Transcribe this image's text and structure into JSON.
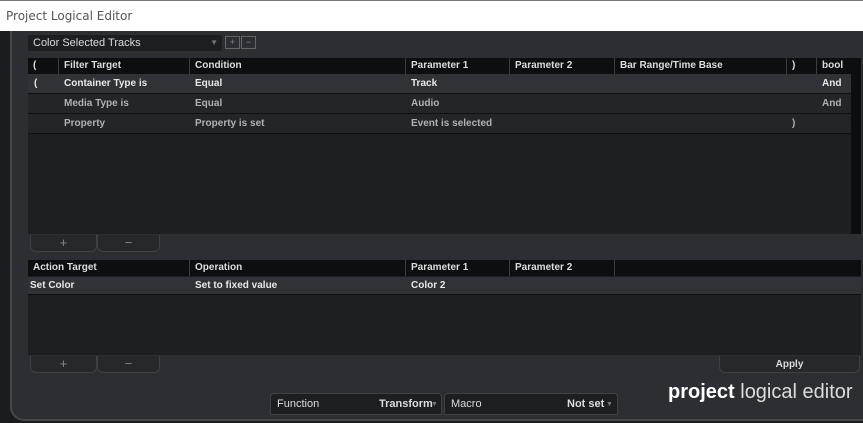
{
  "window": {
    "title": "Project Logical Editor"
  },
  "preset": {
    "value": "Color Selected Tracks",
    "icons": [
      "add-preset-icon",
      "remove-preset-icon"
    ]
  },
  "filter_table": {
    "headers": [
      "(",
      "Filter Target",
      "Condition",
      "Parameter 1",
      "Parameter 2",
      "Bar Range/Time Base",
      ")",
      "bool"
    ],
    "rows": [
      [
        "(",
        "Container Type is",
        "Equal",
        "Track",
        "",
        "",
        "",
        "And"
      ],
      [
        "",
        "Media Type is",
        "Equal",
        "Audio",
        "",
        "",
        "",
        "And"
      ],
      [
        "",
        "Property",
        "Property is set",
        "Event is selected",
        "",
        "",
        ")",
        ""
      ]
    ]
  },
  "action_table": {
    "headers": [
      "Action Target",
      "Operation",
      "Parameter 1",
      "Parameter 2"
    ],
    "rows": [
      [
        "Set Color",
        "Set to fixed value",
        "Color 2",
        ""
      ]
    ]
  },
  "buttons": {
    "add": "+",
    "remove": "−",
    "apply": "Apply"
  },
  "function": {
    "label": "Function",
    "value": "Transform"
  },
  "macro": {
    "label": "Macro",
    "value": "Not set"
  },
  "logo": {
    "bold": "project",
    "rest": " logical editor"
  }
}
